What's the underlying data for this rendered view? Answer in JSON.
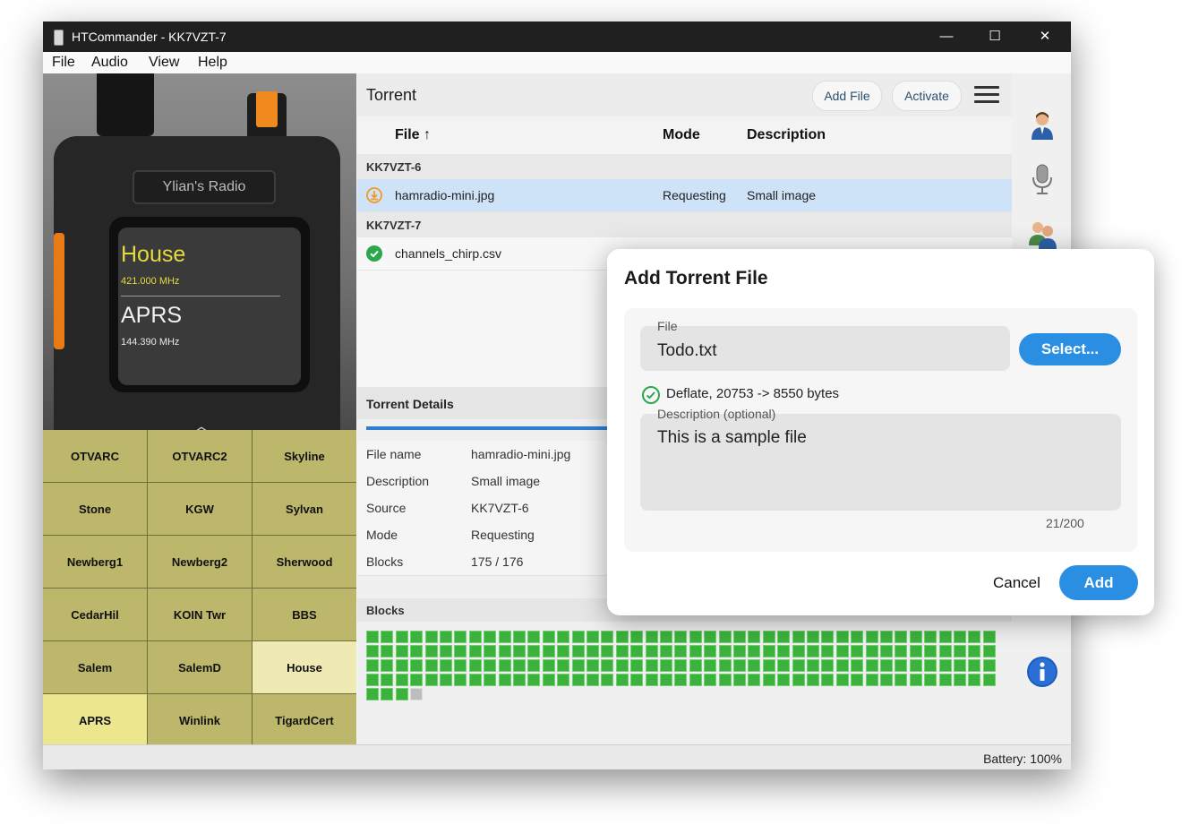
{
  "window": {
    "title": "HTCommander - KK7VZT-7",
    "minimize": "—",
    "maximize": "☐",
    "close": "✕"
  },
  "menu": [
    "File",
    "Audio",
    "View",
    "Help"
  ],
  "radio": {
    "brand": "Ylian's Radio",
    "channel_a": "House",
    "freq_a": "421.000 MHz",
    "channel_b": "APRS",
    "freq_b": "144.390 MHz",
    "accent_color": "#e4dc3c"
  },
  "channels": [
    {
      "label": "OTVARC",
      "state": "normal"
    },
    {
      "label": "OTVARC2",
      "state": "normal"
    },
    {
      "label": "Skyline",
      "state": "normal"
    },
    {
      "label": "Stone",
      "state": "normal"
    },
    {
      "label": "KGW",
      "state": "normal"
    },
    {
      "label": "Sylvan",
      "state": "normal"
    },
    {
      "label": "Newberg1",
      "state": "normal"
    },
    {
      "label": "Newberg2",
      "state": "normal"
    },
    {
      "label": "Sherwood",
      "state": "normal"
    },
    {
      "label": "CedarHil",
      "state": "normal"
    },
    {
      "label": "KOIN Twr",
      "state": "normal"
    },
    {
      "label": "BBS",
      "state": "normal"
    },
    {
      "label": "Salem",
      "state": "normal"
    },
    {
      "label": "SalemD",
      "state": "normal"
    },
    {
      "label": "House",
      "state": "light"
    },
    {
      "label": "APRS",
      "state": "selected"
    },
    {
      "label": "Winlink",
      "state": "normal"
    },
    {
      "label": "TigardCert",
      "state": "normal"
    }
  ],
  "torrent": {
    "title": "Torrent",
    "add_file_label": "Add File",
    "activate_label": "Activate",
    "columns": {
      "file": "File",
      "sort_indicator": "↑",
      "mode": "Mode",
      "description": "Description"
    },
    "groups": [
      {
        "name": "KK7VZT-6",
        "rows": [
          {
            "file": "hamradio-mini.jpg",
            "mode": "Requesting",
            "description": "Small image",
            "status_icon": "download-pending-icon",
            "selected": true
          }
        ]
      },
      {
        "name": "KK7VZT-7",
        "rows": [
          {
            "file": "channels_chirp.csv",
            "mode": "",
            "description": "",
            "status_icon": "check-icon",
            "selected": false
          }
        ]
      }
    ]
  },
  "details": {
    "title": "Torrent Details",
    "rows": [
      {
        "key": "File name",
        "value": "hamradio-mini.jpg"
      },
      {
        "key": "Description",
        "value": "Small image"
      },
      {
        "key": "Source",
        "value": "KK7VZT-6"
      },
      {
        "key": "Mode",
        "value": "Requesting"
      },
      {
        "key": "Blocks",
        "value": "175 / 176"
      }
    ],
    "blocks_title": "Blocks",
    "blocks_received": 175,
    "blocks_total": 176
  },
  "side_icons": [
    "user-icon",
    "microphone-icon",
    "users-icon",
    "info-icon"
  ],
  "status": {
    "battery": "Battery: 100%"
  },
  "dialog": {
    "title": "Add Torrent File",
    "file_label": "File",
    "file_value": "Todo.txt",
    "select_label": "Select...",
    "compression_note": "Deflate, 20753 -> 8550 bytes",
    "description_label": "Description (optional)",
    "description_value": "This is a sample file",
    "counter": "21/200",
    "cancel_label": "Cancel",
    "add_label": "Add"
  },
  "colors": {
    "accent": "#2a8fe2",
    "success": "#2ca84c",
    "pending": "#f39a1e",
    "channel_button": "#bdb76b"
  }
}
